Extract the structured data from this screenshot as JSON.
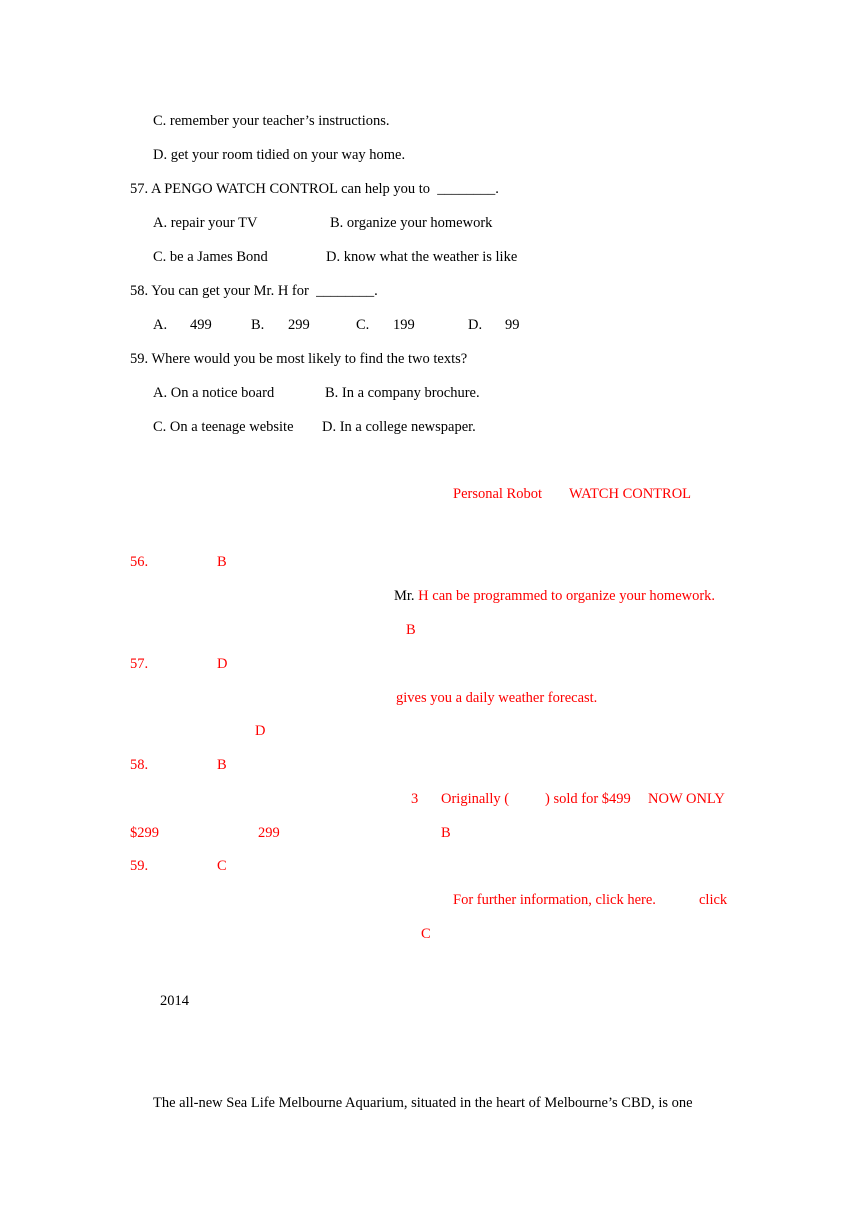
{
  "document": {
    "questions": [
      {
        "continued_options": [
          "C. remember your teacher’s instructions.",
          "D. get your room tidied on your way home."
        ]
      },
      {
        "number": "57.",
        "stem": "57. A PENGO WATCH CONTROL can help you to  ________.",
        "options": [
          "A. repair your TV",
          "B. organize your homework",
          "C. be a James Bond",
          "D. know what the weather is like"
        ]
      },
      {
        "number": "58.",
        "stem": "58. You can get your Mr. H for  ________.",
        "options": [
          "A.",
          "499",
          "B.",
          "299",
          "C.",
          "199",
          "D.",
          "99"
        ]
      },
      {
        "number": "59.",
        "stem": "59. Where would you be most likely to find the two texts?",
        "options": [
          "A. On a notice board",
          "B. In a company brochure.",
          "C. On a teenage website",
          "D. In a college newspaper."
        ]
      }
    ],
    "answer_key": {
      "heading": [
        "Personal Robot",
        "WATCH CONTROL"
      ],
      "items": [
        {
          "number": "56.",
          "answer": "B",
          "quote_prefix": "Mr.",
          "quote": "H can be programmed to organize your homework.",
          "conclusion": "B"
        },
        {
          "number": "57.",
          "answer": "D",
          "quote": "gives you a daily weather forecast.",
          "conclusion": "D"
        },
        {
          "number": "58.",
          "answer": "B",
          "para": "3",
          "quote": "Originally (",
          "quote_b": ") sold for $499",
          "quote_c": "NOW ONLY",
          "line2_a": "$299",
          "line2_b": "299",
          "conclusion": "B"
        },
        {
          "number": "59.",
          "answer": "C",
          "quote": "For further information, click here.",
          "keyword": "click",
          "conclusion": "C"
        }
      ]
    },
    "next_passage": {
      "year": "2014",
      "first_line": "The all-new Sea Life Melbourne Aquarium, situated in the heart of Melbourne’s CBD, is one"
    }
  }
}
